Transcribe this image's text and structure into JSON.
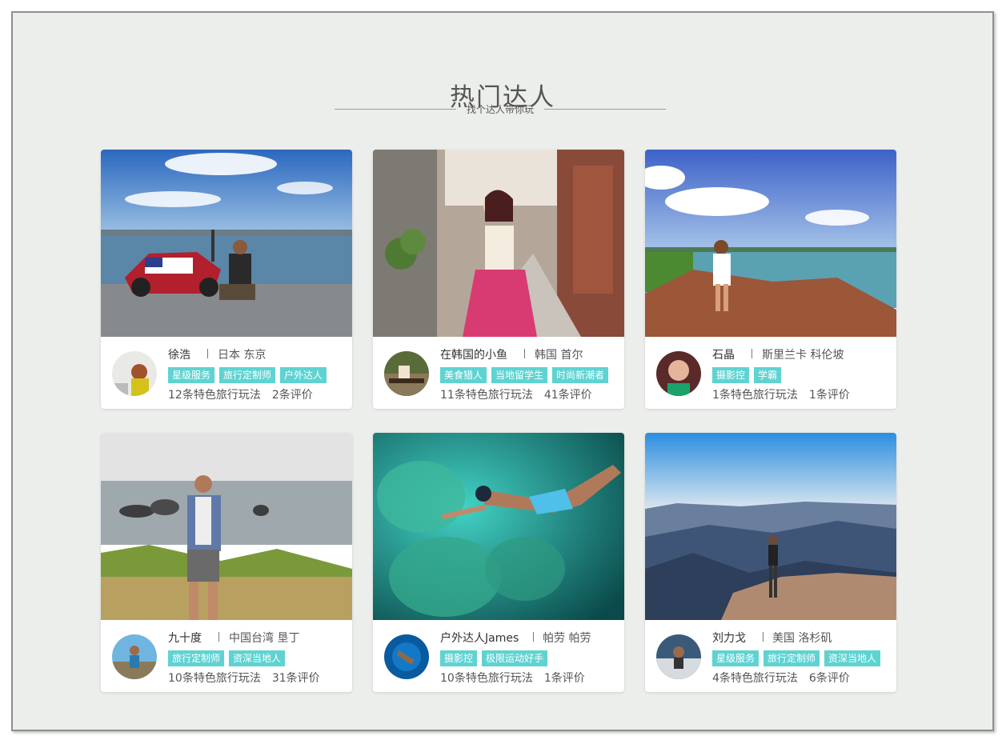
{
  "header": {
    "title": "热门达人",
    "subtitle": "找个达人带你玩"
  },
  "colors": {
    "tag_bg": "#5ed3d2",
    "page_bg": "#eceeeb"
  },
  "cards": [
    {
      "name": "徐浩",
      "location": "日本 东京",
      "tags": [
        "星级服务",
        "旅行定制师",
        "户外达人"
      ],
      "plays": "12条特色旅行玩法",
      "reviews": "2条评价",
      "photo": "motorcycle-lakeside-photo"
    },
    {
      "name": "在韩国的小鱼",
      "location": "韩国 首尔",
      "tags": [
        "美食猎人",
        "当地留学生",
        "时尚新潮者"
      ],
      "plays": "11条特色旅行玩法",
      "reviews": "41条评价",
      "photo": "hanbok-alley-photo"
    },
    {
      "name": "石晶",
      "location": "斯里兰卡 科伦坡",
      "tags": [
        "摄影控",
        "学霸"
      ],
      "plays": "1条特色旅行玩法",
      "reviews": "1条评价",
      "photo": "coast-rock-photo"
    },
    {
      "name": "九十度",
      "location": "中国台湾 垦丁",
      "tags": [
        "旅行定制师",
        "资深当地人"
      ],
      "plays": "10条特色旅行玩法",
      "reviews": "31条评价",
      "photo": "seaside-man-photo"
    },
    {
      "name": "户外达人James",
      "location": "帕劳 帕劳",
      "tags": [
        "摄影控",
        "极限运动好手"
      ],
      "plays": "10条特色旅行玩法",
      "reviews": "1条评价",
      "photo": "underwater-snorkel-photo"
    },
    {
      "name": "刘力戈",
      "location": "美国 洛杉矶",
      "tags": [
        "星级服务",
        "旅行定制师",
        "资深当地人"
      ],
      "plays": "4条特色旅行玩法",
      "reviews": "6条评价",
      "photo": "grand-canyon-photo"
    }
  ]
}
